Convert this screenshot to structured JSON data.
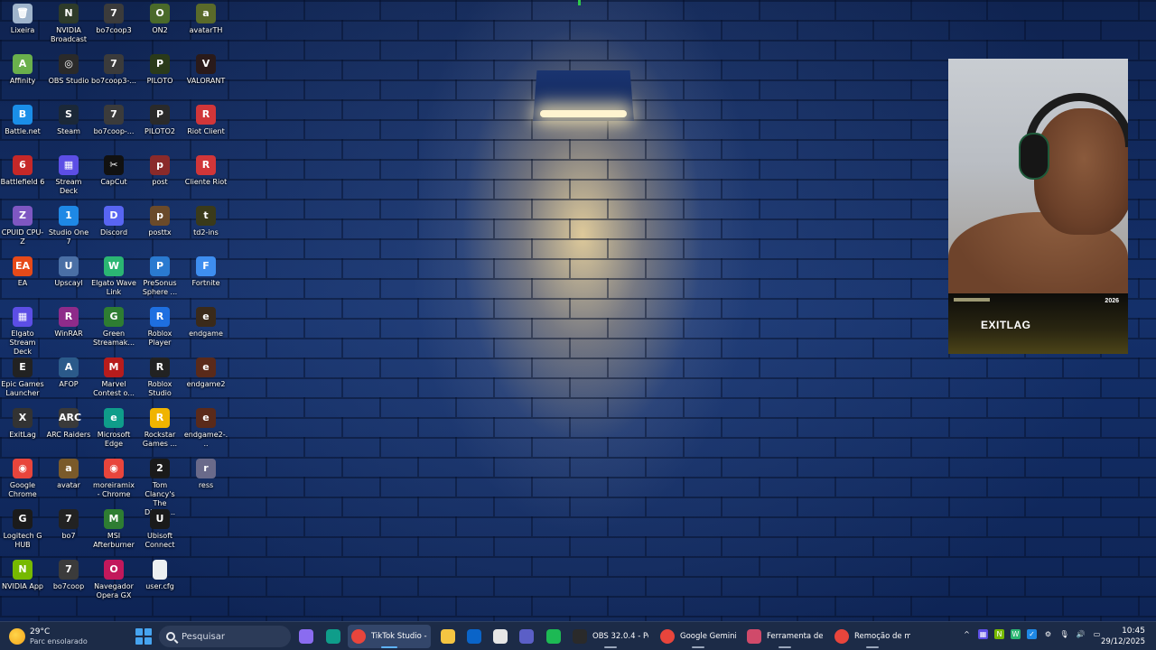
{
  "desktop": {
    "icons": [
      {
        "label": "Lixeira",
        "icon": "recycle-bin-icon",
        "color": "#9fb4cc",
        "glyph": "🗑"
      },
      {
        "label": "Affinity",
        "icon": "affinity-icon",
        "color": "#6ab04c",
        "glyph": "A"
      },
      {
        "label": "Battle.net",
        "icon": "battlenet-icon",
        "color": "#1a8ee8",
        "glyph": "B"
      },
      {
        "label": "Battlefield 6",
        "icon": "battlefield-icon",
        "color": "#c62828",
        "glyph": "6"
      },
      {
        "label": "CPUID CPU-Z",
        "icon": "cpuz-icon",
        "color": "#7e57c2",
        "glyph": "Z"
      },
      {
        "label": "EA",
        "icon": "ea-icon",
        "color": "#e64a19",
        "glyph": "EA"
      },
      {
        "label": "Elgato Stream Deck",
        "icon": "stream-deck-icon",
        "color": "#5c4ee5",
        "glyph": "▦"
      },
      {
        "label": "Epic Games Launcher",
        "icon": "epic-games-icon",
        "color": "#222222",
        "glyph": "E"
      },
      {
        "label": "ExitLag",
        "icon": "exitlag-icon",
        "color": "#333333",
        "glyph": "X"
      },
      {
        "label": "Google Chrome",
        "icon": "chrome-icon",
        "color": "#e8453c",
        "glyph": "◉"
      },
      {
        "label": "Logitech G HUB",
        "icon": "logitech-icon",
        "color": "#1b1b1b",
        "glyph": "G"
      },
      {
        "label": "NVIDIA App",
        "icon": "nvidia-icon",
        "color": "#76b900",
        "glyph": "N"
      },
      {
        "label": "NVIDIA Broadcast",
        "icon": "nvidia-broadcast-icon",
        "color": "#2e3b2a",
        "glyph": "N"
      },
      {
        "label": "OBS Studio",
        "icon": "obs-icon",
        "color": "#2a2a2a",
        "glyph": "◎"
      },
      {
        "label": "Steam",
        "icon": "steam-icon",
        "color": "#1b2838",
        "glyph": "S"
      },
      {
        "label": "Stream Deck",
        "icon": "stream-deck-icon",
        "color": "#5c4ee5",
        "glyph": "▦"
      },
      {
        "label": "Studio One 7",
        "icon": "studio-one-icon",
        "color": "#1e88e5",
        "glyph": "1"
      },
      {
        "label": "Upscayl",
        "icon": "upscayl-icon",
        "color": "#4a6fa5",
        "glyph": "U"
      },
      {
        "label": "WinRAR",
        "icon": "winrar-icon",
        "color": "#8e2b8a",
        "glyph": "R"
      },
      {
        "label": "AFOP",
        "icon": "afop-icon",
        "color": "#2b5a8a",
        "glyph": "A"
      },
      {
        "label": "ARC Raiders",
        "icon": "arc-raiders-icon",
        "color": "#3a3a3a",
        "glyph": "ARC"
      },
      {
        "label": "avatar",
        "icon": "avatar-game-icon",
        "color": "#7a5a2a",
        "glyph": "a"
      },
      {
        "label": "bo7",
        "icon": "bo7-icon",
        "color": "#222222",
        "glyph": "7"
      },
      {
        "label": "bo7coop",
        "icon": "bo7coop-icon",
        "color": "#3b3b3b",
        "glyph": "7"
      },
      {
        "label": "bo7coop3",
        "icon": "bo7coop3-icon",
        "color": "#3b3b3b",
        "glyph": "7"
      },
      {
        "label": "bo7coop3-...",
        "icon": "bo7coop3-shortcut-icon",
        "color": "#3b3b3b",
        "glyph": "7"
      },
      {
        "label": "bo7coop-...",
        "icon": "bo7coop-shortcut-icon",
        "color": "#3b3b3b",
        "glyph": "7"
      },
      {
        "label": "CapCut",
        "icon": "capcut-icon",
        "color": "#111111",
        "glyph": "✂"
      },
      {
        "label": "Discord",
        "icon": "discord-icon",
        "color": "#5865f2",
        "glyph": "D"
      },
      {
        "label": "Elgato Wave Link",
        "icon": "wave-link-icon",
        "color": "#2bb673",
        "glyph": "W"
      },
      {
        "label": "Green Streamak...",
        "icon": "green-streamak-icon",
        "color": "#2e7d32",
        "glyph": "G"
      },
      {
        "label": "Marvel Contest o...",
        "icon": "marvel-contest-icon",
        "color": "#b71c1c",
        "glyph": "M"
      },
      {
        "label": "Microsoft Edge",
        "icon": "edge-icon",
        "color": "#0f9d8a",
        "glyph": "e"
      },
      {
        "label": "moreiramix - Chrome",
        "icon": "chrome-profile-icon",
        "color": "#e8453c",
        "glyph": "◉"
      },
      {
        "label": "MSI Afterburner",
        "icon": "msi-afterburner-icon",
        "color": "#2e7d32",
        "glyph": "M"
      },
      {
        "label": "Navegador Opera GX",
        "icon": "opera-gx-icon",
        "color": "#c2185b",
        "glyph": "O"
      },
      {
        "label": "ON2",
        "icon": "on2-icon",
        "color": "#4a6a2a",
        "glyph": "O"
      },
      {
        "label": "PILOTO",
        "icon": "piloto-icon",
        "color": "#2a3a1a",
        "glyph": "P"
      },
      {
        "label": "PILOTO2",
        "icon": "piloto2-icon",
        "color": "#2a2a2a",
        "glyph": "P"
      },
      {
        "label": "post",
        "icon": "post-icon",
        "color": "#8a2a2a",
        "glyph": "p"
      },
      {
        "label": "posttx",
        "icon": "posttx-icon",
        "color": "#6a4a2a",
        "glyph": "p"
      },
      {
        "label": "PreSonus Sphere ...",
        "icon": "presonus-icon",
        "color": "#2a7ad0",
        "glyph": "P"
      },
      {
        "label": "Roblox Player",
        "icon": "roblox-icon",
        "color": "#1e6fe0",
        "glyph": "R"
      },
      {
        "label": "Roblox Studio",
        "icon": "roblox-studio-icon",
        "color": "#222222",
        "glyph": "R"
      },
      {
        "label": "Rockstar Games ...",
        "icon": "rockstar-icon",
        "color": "#f0b400",
        "glyph": "R"
      },
      {
        "label": "Tom Clancy's The Divisio...",
        "icon": "division-icon",
        "color": "#1a1a1a",
        "glyph": "2"
      },
      {
        "label": "Ubisoft Connect",
        "icon": "ubisoft-icon",
        "color": "#1a1a1a",
        "glyph": "U"
      },
      {
        "label": "user.cfg",
        "icon": "file-icon",
        "color": "#eceff1",
        "glyph": ""
      },
      {
        "label": "avatarTH",
        "icon": "avatarth-icon",
        "color": "#5a6a2a",
        "glyph": "a"
      },
      {
        "label": "VALORANT",
        "icon": "valorant-icon",
        "color": "#2a1a1a",
        "glyph": "V"
      },
      {
        "label": "Riot Client",
        "icon": "riot-client-icon",
        "color": "#d13639",
        "glyph": "R"
      },
      {
        "label": "Cliente Riot",
        "icon": "riot-client-icon",
        "color": "#d13639",
        "glyph": "R"
      },
      {
        "label": "td2-ins",
        "icon": "td2-icon",
        "color": "#3a3a1a",
        "glyph": "t"
      },
      {
        "label": "Fortnite",
        "icon": "fortnite-icon",
        "color": "#3e8ef0",
        "glyph": "F"
      },
      {
        "label": "endgame",
        "icon": "endgame-icon",
        "color": "#3a2a1a",
        "glyph": "e"
      },
      {
        "label": "endgame2",
        "icon": "endgame2-icon",
        "color": "#5a2a1a",
        "glyph": "e"
      },
      {
        "label": "endgame2-...",
        "icon": "endgame2-shortcut-icon",
        "color": "#5a2a1a",
        "glyph": "e"
      },
      {
        "label": "ress",
        "icon": "ress-icon",
        "color": "#6a6a8a",
        "glyph": "r"
      }
    ]
  },
  "overlay": {
    "brand": "EXITLAG",
    "year": "2026"
  },
  "taskbar": {
    "weather": {
      "temp": "29°C",
      "desc": "Parc ensolarado"
    },
    "search_placeholder": "Pesquisar",
    "apps": [
      {
        "name": "",
        "icon": "copilot-icon",
        "color": "#8a6cf0"
      },
      {
        "name": "",
        "icon": "edge-icon",
        "color": "#0f9d8a"
      },
      {
        "name": "TikTok Studio - Go",
        "icon": "chrome-icon",
        "color": "#e8453c",
        "active": true
      },
      {
        "name": "",
        "icon": "file-explorer-icon",
        "color": "#f5c542"
      },
      {
        "name": "",
        "icon": "outlook-icon",
        "color": "#0a64c8"
      },
      {
        "name": "",
        "icon": "store-icon",
        "color": "#e6e6e6"
      },
      {
        "name": "",
        "icon": "teams-icon",
        "color": "#5b5fc7"
      },
      {
        "name": "",
        "icon": "spotify-icon",
        "color": "#1db954"
      },
      {
        "name": "OBS 32.0.4 - Perfil",
        "icon": "obs-icon",
        "color": "#2a2a2a"
      },
      {
        "name": "Google Gemini - G",
        "icon": "chrome-icon",
        "color": "#e8453c"
      },
      {
        "name": "Ferramenta de Ca",
        "icon": "snipping-tool-icon",
        "color": "#d04a6a"
      },
      {
        "name": "Remoção de marc",
        "icon": "chrome-icon",
        "color": "#e8453c"
      }
    ],
    "tray": [
      {
        "icon": "chevron-up-icon",
        "glyph": "^",
        "color": "transparent"
      },
      {
        "icon": "stream-deck-tray-icon",
        "glyph": "▦",
        "color": "#5c4ee5"
      },
      {
        "icon": "nvidia-tray-icon",
        "glyph": "N",
        "color": "#76b900"
      },
      {
        "icon": "wave-link-tray-icon",
        "glyph": "W",
        "color": "#2bb673"
      },
      {
        "icon": "defender-tray-icon",
        "glyph": "✓",
        "color": "#1e88e5"
      },
      {
        "icon": "settings-tray-icon",
        "glyph": "⚙",
        "color": "transparent"
      },
      {
        "icon": "microphone-icon",
        "glyph": "🎙",
        "color": "transparent"
      },
      {
        "icon": "volume-icon",
        "glyph": "🔊",
        "color": "transparent"
      },
      {
        "icon": "network-icon",
        "glyph": "▭",
        "color": "transparent"
      }
    ],
    "clock": {
      "time": "10:45",
      "date": "29/12/2025"
    }
  }
}
